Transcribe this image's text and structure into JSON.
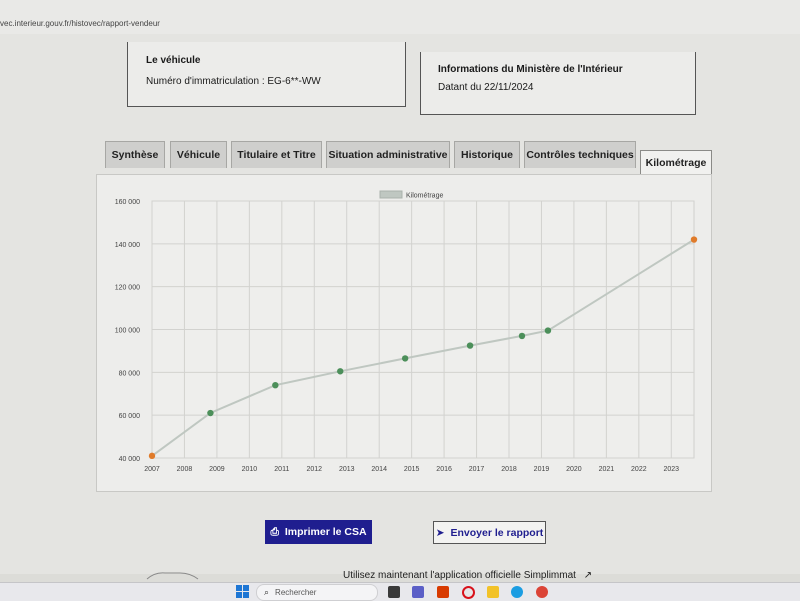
{
  "browser": {
    "url": "vec.interieur.gouv.fr/histovec/rapport-vendeur"
  },
  "vehicle_box": {
    "title": "Le véhicule",
    "plate_label": "Numéro d'immatriculation : EG-6**-WW"
  },
  "ministry_box": {
    "title": "Informations du Ministère de l'Intérieur",
    "date_label": "Datant du 22/11/2024"
  },
  "tabs": [
    {
      "label": "Synthèse"
    },
    {
      "label": "Véhicule"
    },
    {
      "label": "Titulaire et Titre"
    },
    {
      "label": "Situation administrative"
    },
    {
      "label": "Historique"
    },
    {
      "label": "Contrôles techniques"
    },
    {
      "label": "Kilométrage",
      "active": true
    }
  ],
  "chart_data": {
    "type": "line",
    "legend": "Kilométrage",
    "legend_position": "top",
    "grid": true,
    "x_ticks": [
      "2007",
      "2008",
      "2009",
      "2010",
      "2011",
      "2012",
      "2013",
      "2014",
      "2015",
      "2016",
      "2017",
      "2018",
      "2019",
      "2020",
      "2021",
      "2022",
      "2023"
    ],
    "y_ticks": [
      "40 000",
      "60 000",
      "80 000",
      "100 000",
      "120 000",
      "140 000",
      "160 000"
    ],
    "ylim": [
      40000,
      160000
    ],
    "xlim": [
      2007,
      2023.7
    ],
    "series": [
      {
        "name": "Kilométrage",
        "points": [
          {
            "x": 2007.0,
            "y": 41000,
            "color": "#e07b2a"
          },
          {
            "x": 2008.8,
            "y": 61000,
            "color": "#4c8f5a"
          },
          {
            "x": 2010.8,
            "y": 74000,
            "color": "#4c8f5a"
          },
          {
            "x": 2012.8,
            "y": 80500,
            "color": "#4c8f5a"
          },
          {
            "x": 2014.8,
            "y": 86500,
            "color": "#4c8f5a"
          },
          {
            "x": 2016.8,
            "y": 92500,
            "color": "#4c8f5a"
          },
          {
            "x": 2018.4,
            "y": 97000,
            "color": "#4c8f5a"
          },
          {
            "x": 2019.2,
            "y": 99500,
            "color": "#4c8f5a"
          },
          {
            "x": 2023.7,
            "y": 142000,
            "color": "#e07b2a"
          }
        ]
      }
    ],
    "line_color": "#bfc7c1"
  },
  "buttons": {
    "print": "Imprimer le CSA",
    "send": "Envoyer le rapport"
  },
  "app_promo": "Utilisez maintenant l'application officielle Simplimmat",
  "taskbar": {
    "search_placeholder": "Rechercher"
  }
}
